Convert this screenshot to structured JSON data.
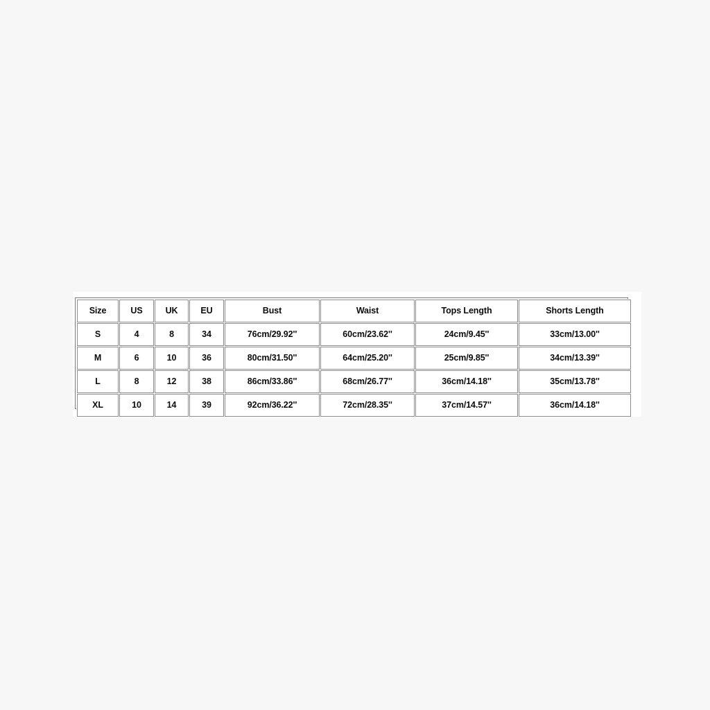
{
  "page": {
    "background_color": "#f8f7f7",
    "card_background_color": "#ffffff",
    "border_color": "#8c8c8c",
    "text_color": "#0b0b0b"
  },
  "size_chart": {
    "columns": [
      "Size",
      "US",
      "UK",
      "EU",
      "Bust",
      "Waist",
      "Tops Length",
      "Shorts Length"
    ],
    "rows": [
      {
        "size": "S",
        "us": "4",
        "uk": "8",
        "eu": "34",
        "bust": "76cm/29.92''",
        "waist": "60cm/23.62''",
        "tops_length": "24cm/9.45''",
        "shorts_length": "33cm/13.00''"
      },
      {
        "size": "M",
        "us": "6",
        "uk": "10",
        "eu": "36",
        "bust": "80cm/31.50''",
        "waist": "64cm/25.20''",
        "tops_length": "25cm/9.85''",
        "shorts_length": "34cm/13.39''"
      },
      {
        "size": "L",
        "us": "8",
        "uk": "12",
        "eu": "38",
        "bust": "86cm/33.86''",
        "waist": "68cm/26.77''",
        "tops_length": "36cm/14.18''",
        "shorts_length": "35cm/13.78''"
      },
      {
        "size": "XL",
        "us": "10",
        "uk": "14",
        "eu": "39",
        "bust": "92cm/36.22''",
        "waist": "72cm/28.35''",
        "tops_length": "37cm/14.57''",
        "shorts_length": "36cm/14.18''"
      }
    ]
  }
}
